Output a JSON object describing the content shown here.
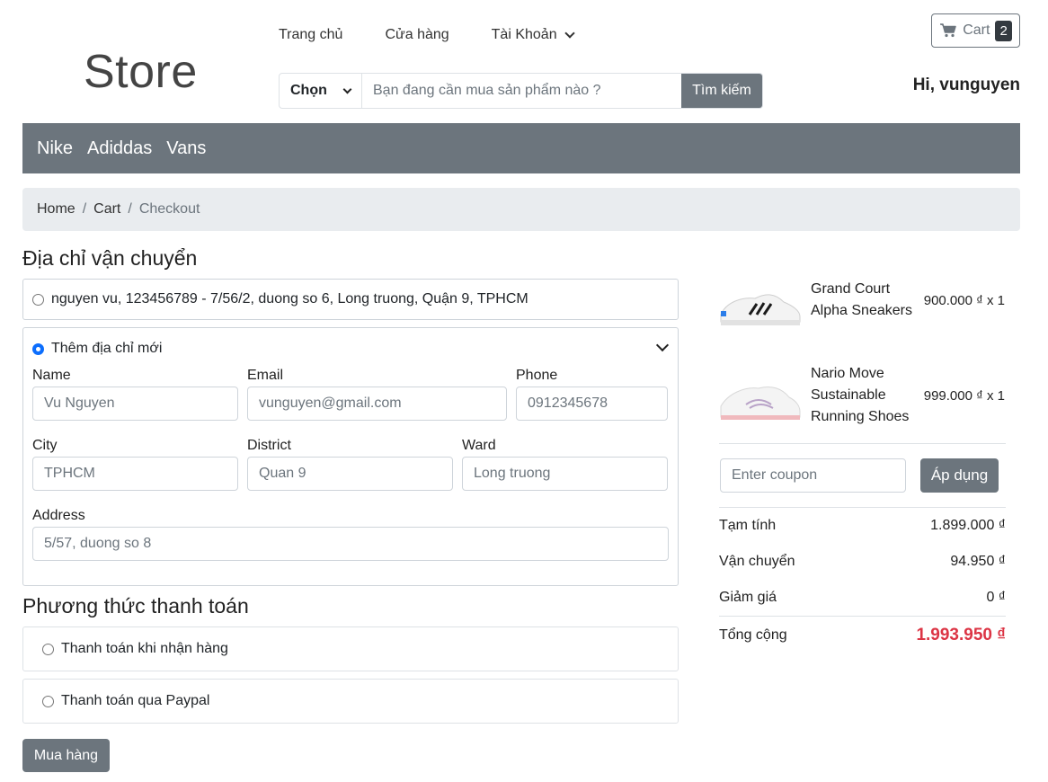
{
  "header": {
    "logo": "Store",
    "nav": [
      "Trang chủ",
      "Cửa hàng",
      "Tài Khoản"
    ],
    "search": {
      "select_label": "Chọn",
      "placeholder": "Bạn đang cần mua sản phẩm nào ?",
      "button": "Tìm kiếm"
    },
    "cart": {
      "label": "Cart",
      "count": "2"
    },
    "greeting": "Hi, vunguyen"
  },
  "categories": [
    "Nike",
    "Adiddas",
    "Vans"
  ],
  "breadcrumb": [
    "Home",
    "Cart",
    "Checkout"
  ],
  "shipping": {
    "title": "Địa chỉ vận chuyển",
    "saved_address": "nguyen vu, 123456789 - 7/56/2, duong so 6, Long truong, Quận 9, TPHCM",
    "new_address_label": "Thêm địa chỉ mới",
    "fields": {
      "name": {
        "label": "Name",
        "placeholder": "Vu Nguyen"
      },
      "email": {
        "label": "Email",
        "placeholder": "vunguyen@gmail.com"
      },
      "phone": {
        "label": "Phone",
        "placeholder": "0912345678"
      },
      "city": {
        "label": "City",
        "placeholder": "TPHCM"
      },
      "district": {
        "label": "District",
        "placeholder": "Quan 9"
      },
      "ward": {
        "label": "Ward",
        "placeholder": "Long truong"
      },
      "address": {
        "label": "Address",
        "placeholder": "5/57, duong so 8"
      }
    }
  },
  "payment": {
    "title": "Phương thức thanh toán",
    "options": [
      "Thanh toán khi nhận hàng",
      "Thanh toán qua Paypal"
    ],
    "submit": "Mua hàng"
  },
  "order": {
    "items": [
      {
        "name": "Grand Court Alpha Sneakers",
        "price": "900.000 ₫ x 1"
      },
      {
        "name": "Nario Move Sustainable Running Shoes",
        "price": "999.000 ₫ x 1"
      }
    ],
    "coupon_placeholder": "Enter coupon",
    "apply": "Áp dụng",
    "summary": {
      "subtotal_label": "Tạm tính",
      "subtotal": "1.899.000 ₫",
      "shipping_label": "Vận chuyển",
      "shipping": "94.950 ₫",
      "discount_label": "Giảm giá",
      "discount": "0 ₫",
      "total_label": "Tổng cộng",
      "total": "1.993.950 ₫"
    }
  }
}
